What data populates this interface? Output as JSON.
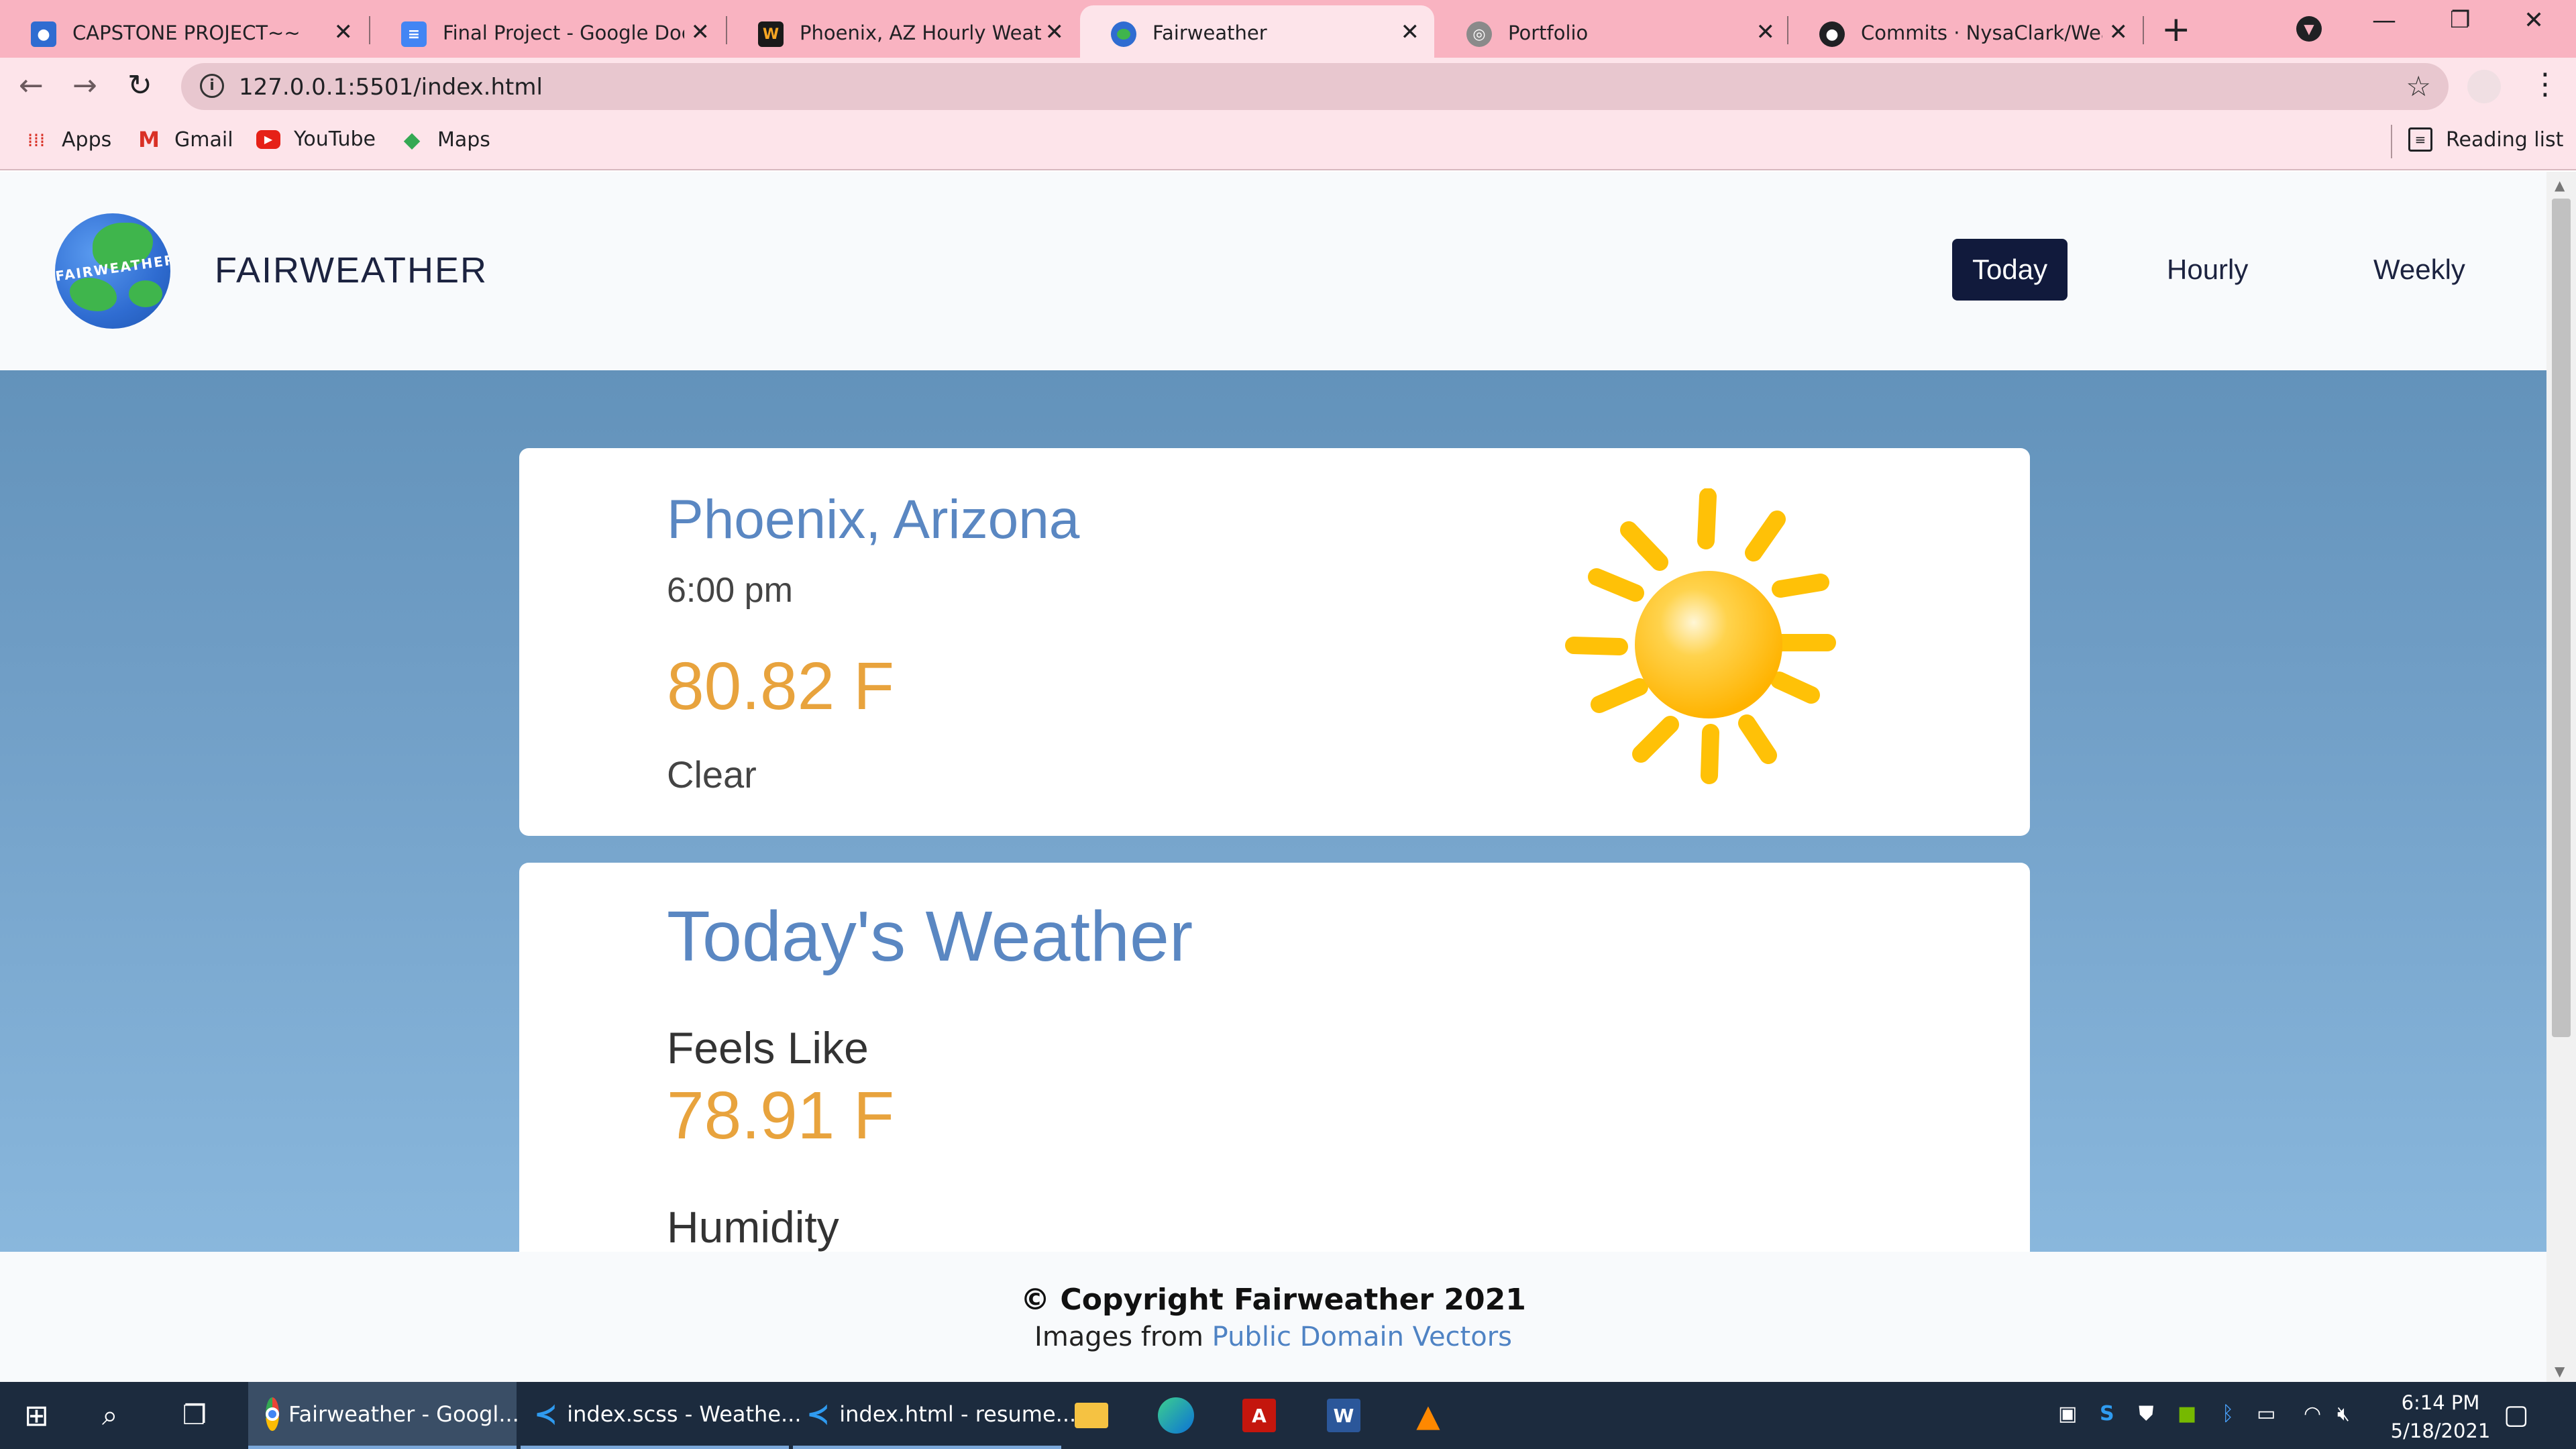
{
  "browser": {
    "tabs": [
      {
        "title": "CAPSTONE PROJECT~~",
        "icon": "contacts-icon",
        "color": "#2f6cd1",
        "active": false
      },
      {
        "title": "Final Project - Google Docs",
        "icon": "docs-icon",
        "color": "#4285f4",
        "active": false
      },
      {
        "title": "Phoenix, AZ Hourly Weathe",
        "icon": "weather-site-icon",
        "color": "#1a1a1a",
        "active": false
      },
      {
        "title": "Fairweather",
        "icon": "globe-icon",
        "color": "#3fb54c",
        "active": true
      },
      {
        "title": "Portfolio",
        "icon": "web-icon",
        "color": "#7a7a7a",
        "active": false
      },
      {
        "title": "Commits · NysaClark/Weath",
        "icon": "github-icon",
        "color": "#202124",
        "active": false
      }
    ],
    "url": "127.0.0.1:5501/index.html",
    "bookmarks": [
      {
        "label": "Apps",
        "icon": "apps-grid-icon"
      },
      {
        "label": "Gmail",
        "icon": "gmail-icon"
      },
      {
        "label": "YouTube",
        "icon": "youtube-icon"
      },
      {
        "label": "Maps",
        "icon": "maps-icon"
      }
    ],
    "reading_list": "Reading list"
  },
  "site": {
    "brand": "FAIRWEATHER",
    "logo_text": "FAIRWEATHER",
    "nav": [
      {
        "label": "Today",
        "active": true
      },
      {
        "label": "Hourly",
        "active": false
      },
      {
        "label": "Weekly",
        "active": false
      }
    ],
    "current": {
      "city": "Phoenix, Arizona",
      "time": "6:00 pm",
      "temp": "80.82 F",
      "condition": "Clear",
      "icon": "sun-icon"
    },
    "today": {
      "title": "Today's Weather",
      "feels_like_label": "Feels Like",
      "feels_like_value": "78.91 F",
      "humidity_label": "Humidity"
    },
    "footer": {
      "copyright": "© Copyright Fairweather 2021",
      "images_prefix": "Images from ",
      "images_link": "Public Domain Vectors"
    }
  },
  "taskbar": {
    "apps": [
      {
        "label": "Fairweather - Googl...",
        "icon": "chrome-icon"
      },
      {
        "label": "index.scss - Weathe...",
        "icon": "vscode-icon"
      },
      {
        "label": "index.html - resume...",
        "icon": "vscode-icon"
      }
    ],
    "pinned": [
      "file-explorer-icon",
      "edge-icon",
      "acrobat-icon",
      "word-icon",
      "vlc-icon"
    ],
    "time": "6:14 PM",
    "date": "5/18/2021"
  },
  "colors": {
    "tab_strip": "#f9b3c1",
    "toolbar": "#fde4ea",
    "nav_active": "#111a3c",
    "accent_blue": "#5a87c2",
    "accent_orange": "#e8a33d",
    "sun": "#ffc107"
  }
}
